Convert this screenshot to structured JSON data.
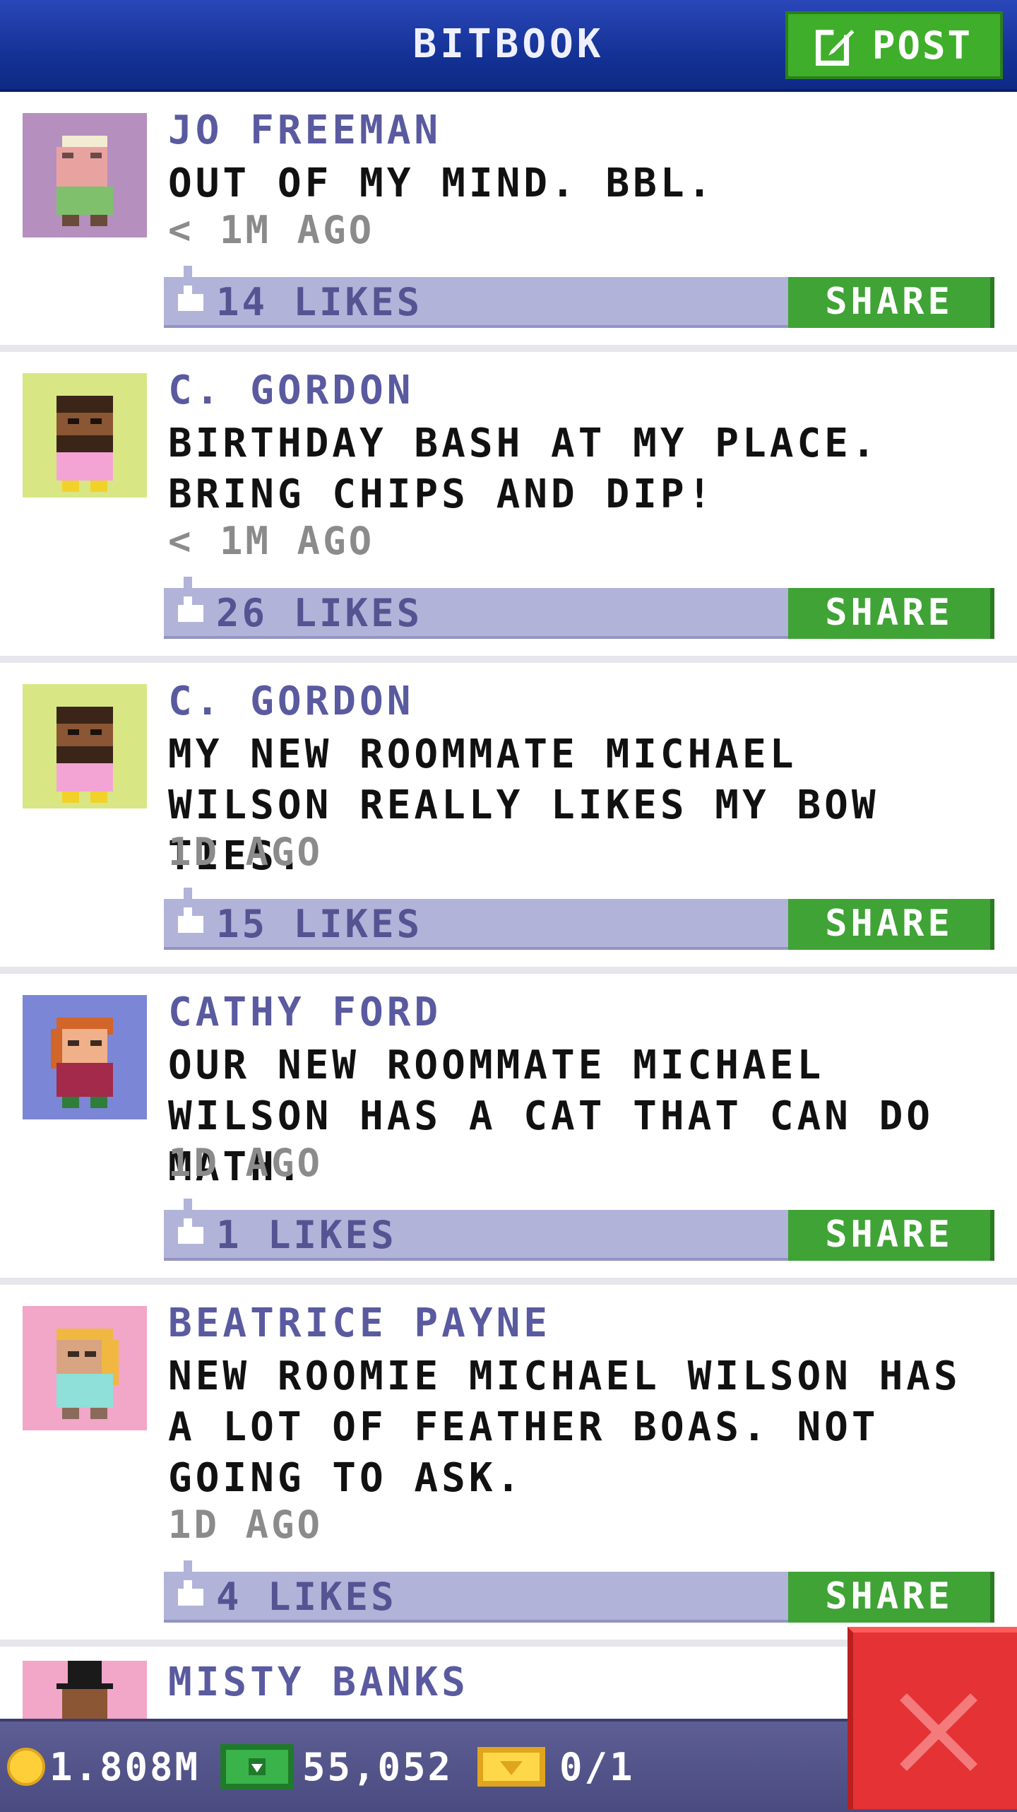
{
  "header": {
    "title": "BITBOOK",
    "post_label": "POST"
  },
  "posts": [
    {
      "author": "JO FREEMAN",
      "text": "OUT OF MY MIND. BBL.",
      "time": "< 1M AGO",
      "likes": "14 LIKES",
      "share": "SHARE",
      "avatar_bg": "#b58fbd"
    },
    {
      "author": "C. GORDON",
      "text": "BIRTHDAY BASH AT MY PLACE. BRING CHIPS AND DIP!",
      "time": "< 1M AGO",
      "likes": "26 LIKES",
      "share": "SHARE",
      "avatar_bg": "#d8e784"
    },
    {
      "author": "C. GORDON",
      "text": "MY NEW ROOMMATE MICHAEL WILSON REALLY LIKES MY BOW TIES.",
      "time": "1D AGO",
      "likes": "15 LIKES",
      "share": "SHARE",
      "avatar_bg": "#d8e784"
    },
    {
      "author": "CATHY FORD",
      "text": "OUR NEW ROOMMATE MICHAEL WILSON HAS A CAT THAT CAN DO MATH.",
      "time": "1D AGO",
      "likes": "1 LIKES",
      "share": "SHARE",
      "avatar_bg": "#7c86d6"
    },
    {
      "author": "BEATRICE PAYNE",
      "text": "NEW ROOMIE MICHAEL WILSON HAS A LOT OF FEATHER BOAS. NOT GOING TO ASK.",
      "time": "1D AGO",
      "likes": "4 LIKES",
      "share": "SHARE",
      "avatar_bg": "#f2a6c8"
    },
    {
      "author": "MISTY BANKS",
      "avatar_bg": "#f2a6c8"
    }
  ],
  "footer": {
    "coins": "1.808M",
    "bux": "55,052",
    "tickets": "0/1"
  },
  "colors": {
    "header": "#143296",
    "share_green": "#3fa335",
    "likes_bar": "#b2b3d8",
    "close_red": "#e53234"
  }
}
